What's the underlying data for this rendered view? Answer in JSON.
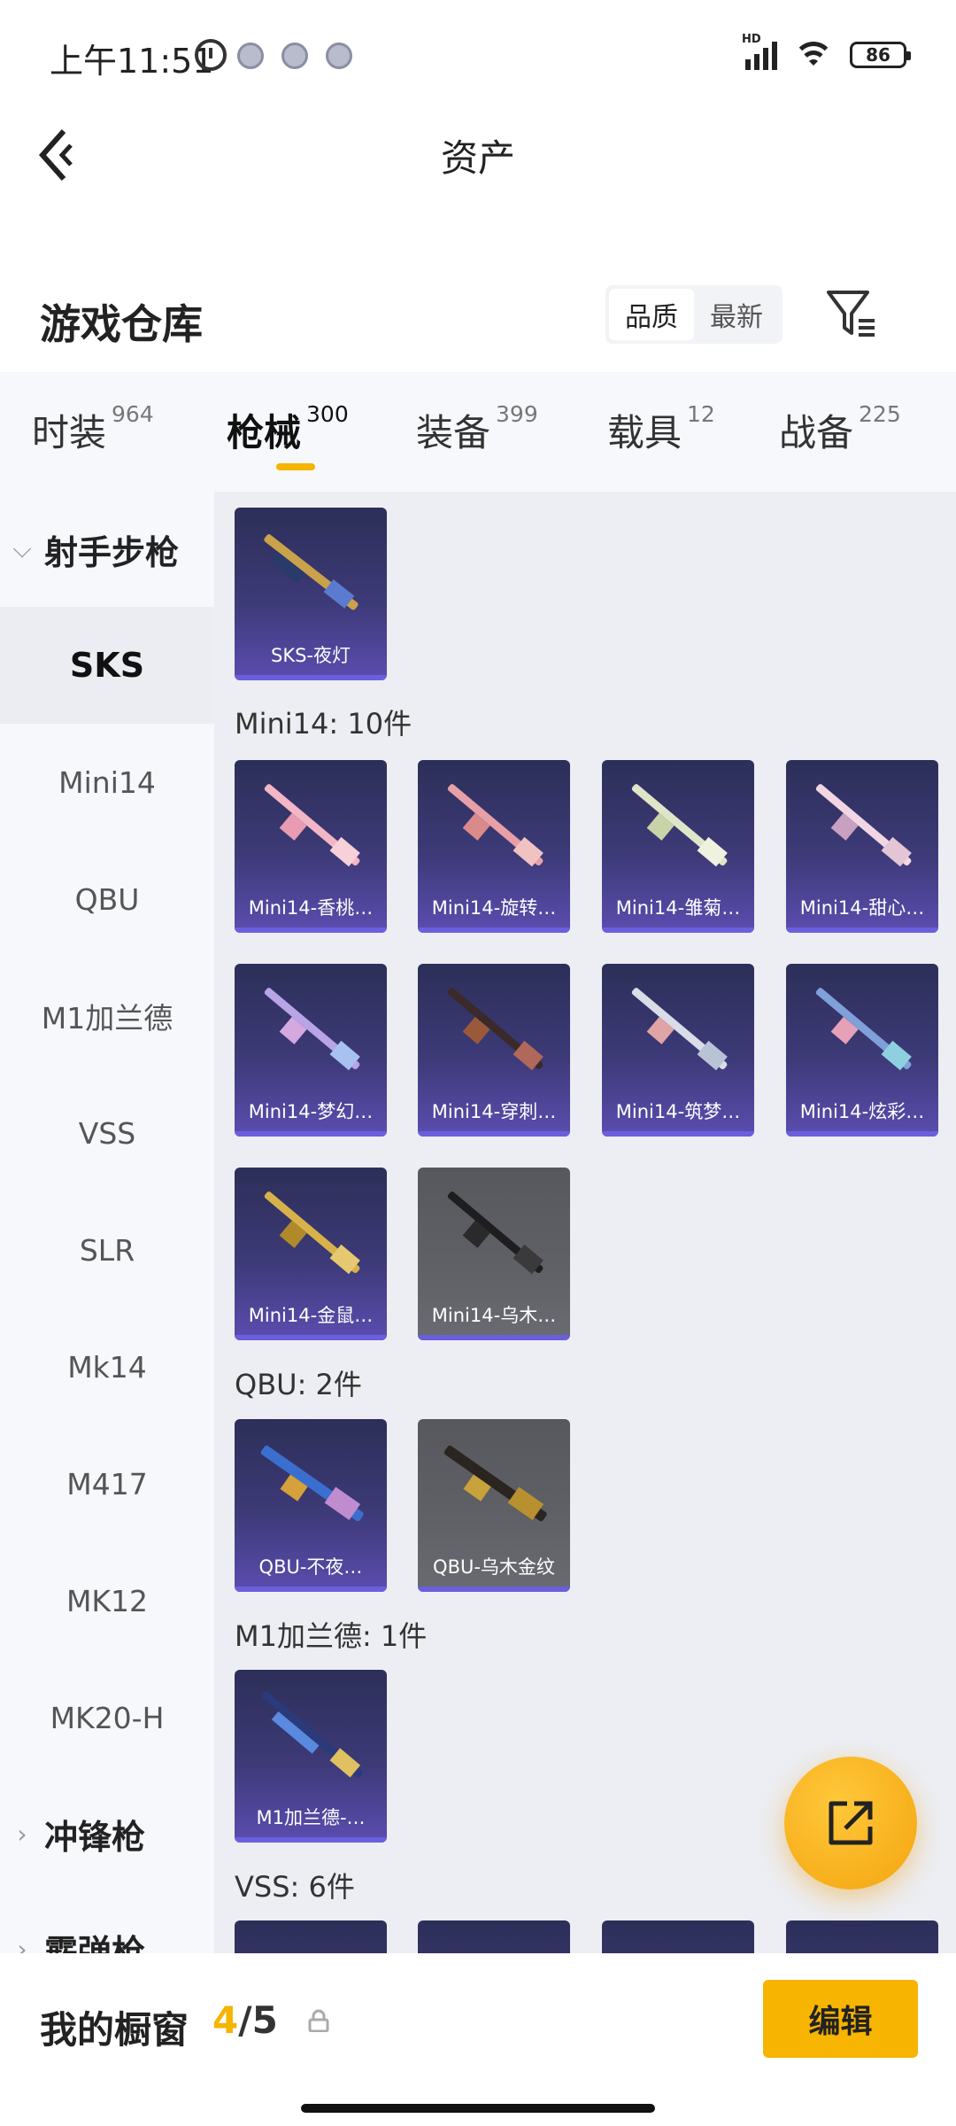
{
  "status_bar": {
    "time": "上午11:51",
    "network": "HD",
    "battery": "86"
  },
  "header": {
    "title": "资产",
    "back_icon": "chevron-left-icon"
  },
  "warehouse": {
    "title": "游戏仓库",
    "sort_options": [
      "品质",
      "最新"
    ],
    "sort_selected": "品质",
    "filter_icon": "filter-icon"
  },
  "tabs": [
    {
      "label": "时装",
      "count": "964"
    },
    {
      "label": "枪械",
      "count": "300",
      "active": true
    },
    {
      "label": "装备",
      "count": "399"
    },
    {
      "label": "载具",
      "count": "12"
    },
    {
      "label": "战备",
      "count": "225"
    }
  ],
  "sidebar": {
    "groups": [
      {
        "label": "射手步枪",
        "expanded": true
      },
      {
        "label": "冲锋枪",
        "expanded": false
      },
      {
        "label": "霰弹枪",
        "expanded": false
      }
    ],
    "items": [
      "SKS",
      "Mini14",
      "QBU",
      "M1加兰德",
      "VSS",
      "SLR",
      "Mk14",
      "M417",
      "MK12",
      "MK20-H"
    ],
    "selected": "SKS"
  },
  "content": {
    "sks_items": [
      "SKS-夜灯"
    ],
    "groups": [
      {
        "label": "Mini14: 10件",
        "items": [
          "Mini14-香桃…",
          "Mini14-旋转…",
          "Mini14-雏菊…",
          "Mini14-甜心…",
          "Mini14-梦幻…",
          "Mini14-穿刺…",
          "Mini14-筑梦…",
          "Mini14-炫彩…",
          "Mini14-金鼠…",
          "Mini14-乌木…"
        ]
      },
      {
        "label": "QBU: 2件",
        "items": [
          "QBU-不夜…",
          "QBU-乌木金纹"
        ]
      },
      {
        "label": "M1加兰德: 1件",
        "items": [
          "M1加兰德-…"
        ]
      },
      {
        "label": "VSS: 6件",
        "items": []
      }
    ]
  },
  "fab": {
    "icon": "share-out-icon"
  },
  "bottom_bar": {
    "label": "我的橱窗",
    "current": "4",
    "total": "/5",
    "lock_icon": "lock-icon",
    "edit_button": "编辑"
  },
  "colors": {
    "accent": "#f5b400",
    "card_purple": "#3d3a78",
    "card_gray": "#606167",
    "content_bg": "#eceef3",
    "sidebar_bg": "#f6f8fc"
  }
}
